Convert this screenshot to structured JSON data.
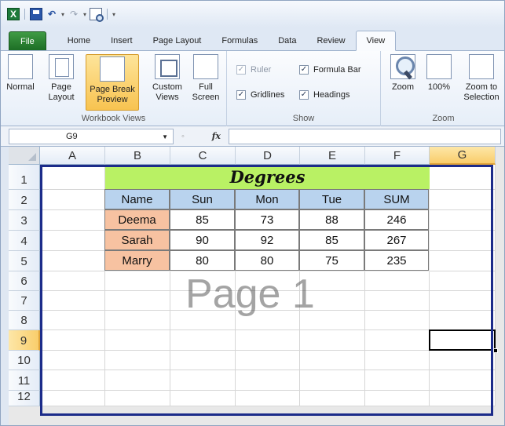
{
  "tabs": [
    "File",
    "Home",
    "Insert",
    "Page Layout",
    "Formulas",
    "Data",
    "Review",
    "View"
  ],
  "ribbon": {
    "workbook_views": {
      "label": "Workbook Views",
      "normal": "Normal",
      "page_layout": [
        "Page",
        "Layout"
      ],
      "page_break_preview": [
        "Page Break",
        "Preview"
      ],
      "custom_views": [
        "Custom",
        "Views"
      ],
      "full_screen": [
        "Full",
        "Screen"
      ]
    },
    "show": {
      "label": "Show",
      "ruler": "Ruler",
      "formula_bar": "Formula Bar",
      "gridlines": "Gridlines",
      "headings": "Headings"
    },
    "zoom": {
      "label": "Zoom",
      "zoom": "Zoom",
      "pct100": "100%",
      "zoom_to_selection": [
        "Zoom to",
        "Selection"
      ]
    }
  },
  "formula_bar": {
    "name_box": "G9",
    "fx": "fx",
    "formula": ""
  },
  "sheet": {
    "columns": [
      "A",
      "B",
      "C",
      "D",
      "E",
      "F",
      "G"
    ],
    "rows": [
      "1",
      "2",
      "3",
      "4",
      "5",
      "6",
      "7",
      "8",
      "9",
      "10",
      "11",
      "12"
    ],
    "title": "Degrees",
    "headers": [
      "Name",
      "Sun",
      "Mon",
      "Tue",
      "SUM"
    ],
    "records": [
      [
        "Deema",
        "85",
        "73",
        "88",
        "246"
      ],
      [
        "Sarah",
        "90",
        "92",
        "85",
        "267"
      ],
      [
        "Marry",
        "80",
        "80",
        "75",
        "235"
      ]
    ],
    "page_watermark": "Page 1",
    "selected_cell": "G9"
  }
}
